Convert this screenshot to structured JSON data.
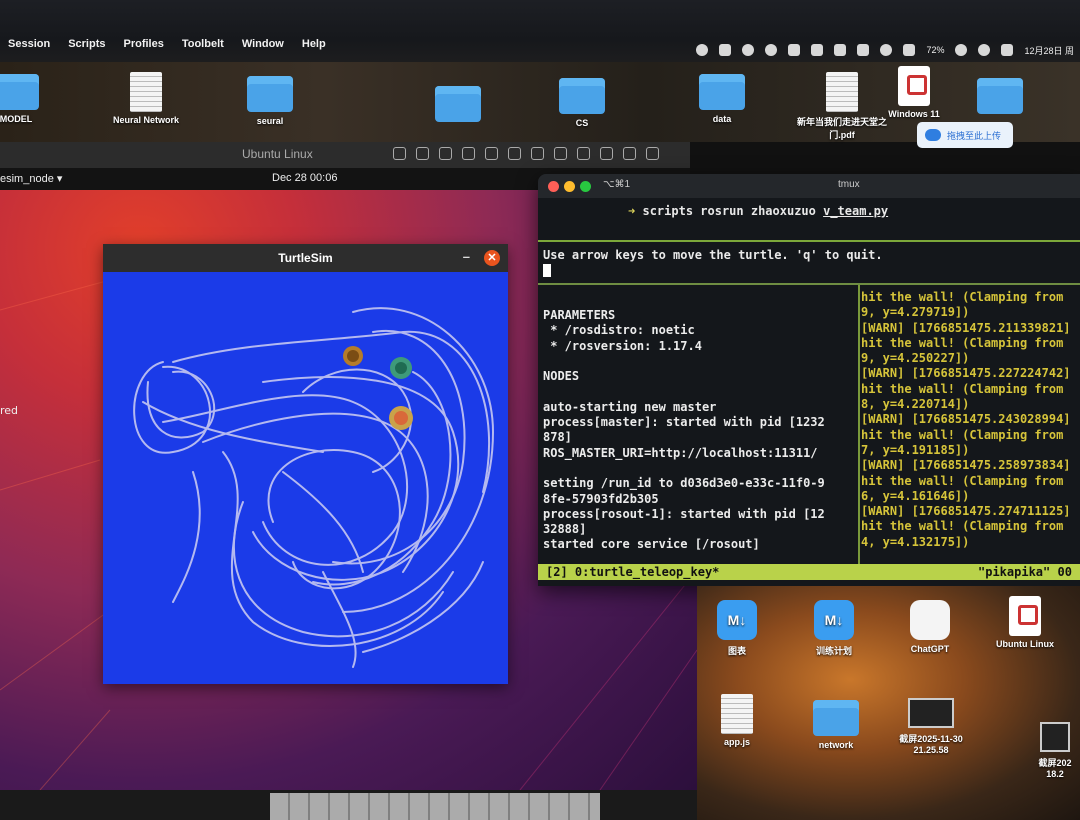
{
  "mac_menu": [
    "Session",
    "Scripts",
    "Profiles",
    "Toolbelt",
    "Window",
    "Help"
  ],
  "mac_status": {
    "battery": "72%",
    "date": "12月28日 周"
  },
  "desktop_top_icons": [
    {
      "label": "MODEL",
      "kind": "folder"
    },
    {
      "label": "Neural Network",
      "kind": "doc"
    },
    {
      "label": "seural",
      "kind": "folder"
    },
    {
      "label": "",
      "kind": "folder"
    },
    {
      "label": "CS",
      "kind": "folder"
    },
    {
      "label": "data",
      "kind": "folder"
    },
    {
      "label": "新年当我们走进天堂之门.pdf",
      "kind": "doc"
    },
    {
      "label": "Windows 11",
      "kind": "pvm"
    },
    {
      "label": "",
      "kind": "folder"
    }
  ],
  "upload_chip": "拖拽至此上传",
  "vm": {
    "title": "Ubuntu Linux"
  },
  "gnome": {
    "app_menu": "esim_node ▾",
    "clock": "Dec 28  00:06"
  },
  "ubuntu_desktop_label": "red",
  "turtlesim": {
    "title": "TurtleSim",
    "minimize": "–",
    "close": "✕"
  },
  "terminal": {
    "tab": "⌥⌘1",
    "title": "tmux",
    "prompt_arrow": "➜",
    "prompt_dir": "scripts",
    "prompt_cmd": " rosrun zhaoxuzuo ",
    "prompt_script": "v_team.py",
    "teleop_msg": "Use arrow keys to move the turtle. 'q' to quit.",
    "left_log": [
      "PARAMETERS",
      " * /rosdistro: noetic",
      " * /rosversion: 1.17.4",
      "",
      "NODES",
      "",
      "auto-starting new master",
      "process[master]: started with pid [1232",
      "878]",
      "ROS_MASTER_URI=http://localhost:11311/",
      "",
      "setting /run_id to d036d3e0-e33c-11f0-9",
      "8fe-57903fd2b305",
      "process[rosout-1]: started with pid [12",
      "32888]",
      "started core service [/rosout]"
    ],
    "right_log": [
      "hit the wall! (Clamping from",
      "9, y=4.279719])",
      "[WARN] [1766851475.211339821]",
      "hit the wall! (Clamping from",
      "9, y=4.250227])",
      "[WARN] [1766851475.227224742]",
      "hit the wall! (Clamping from",
      "8, y=4.220714])",
      "[WARN] [1766851475.243028994]",
      "hit the wall! (Clamping from",
      "7, y=4.191185])",
      "[WARN] [1766851475.258973834]",
      "hit the wall! (Clamping from",
      "6, y=4.161646])",
      "[WARN] [1766851475.274711125]",
      "hit the wall! (Clamping from",
      "4, y=4.132175])"
    ],
    "status_window": "[2] 0:turtle_teleop_key*",
    "status_host": "\"pikapika\" 00"
  },
  "desktop_bottom_icons": [
    {
      "label": "图表",
      "kind": "md"
    },
    {
      "label": "训练计划",
      "kind": "md"
    },
    {
      "label": "ChatGPT",
      "kind": "gpt"
    },
    {
      "label": "Ubuntu Linux",
      "kind": "pvm"
    },
    {
      "label": "app.js",
      "kind": "doc"
    },
    {
      "label": "network",
      "kind": "folder"
    },
    {
      "label": "截屏2025-11-30 21.25.58",
      "kind": "shot"
    },
    {
      "label": "截屏202 18.2",
      "kind": "shot"
    }
  ],
  "colors": {
    "turtlesim_bg": "#1b3be8",
    "trail": "#b4b9f0",
    "tmux_status": "#b9d24a",
    "warn_text": "#d6c43a"
  }
}
